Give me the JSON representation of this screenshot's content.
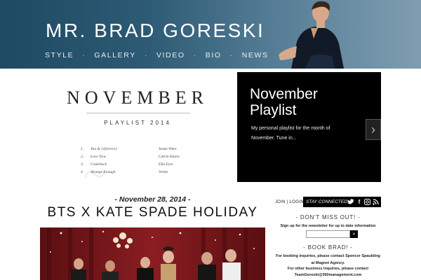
{
  "header": {
    "title": "MR. BRAD GORESKI",
    "nav": [
      "STYLE",
      "GALLERY",
      "VIDEO",
      "BIO",
      "NEWS"
    ],
    "separator": "·"
  },
  "feature": {
    "image_title": "NOVEMBER",
    "image_subtitle": "PLAYLIST 2014",
    "tracks": [
      {
        "num": "1.",
        "song": "You & I (forever)",
        "artist": "Jessie Ware"
      },
      {
        "num": "2.",
        "song": "Love Now",
        "artist": "Calvin Harris"
      },
      {
        "num": "3.",
        "song": "Comeback",
        "artist": "Ella Eyre"
      },
      {
        "num": "4.",
        "song": "Strange Enough",
        "artist": "Verite"
      }
    ],
    "panel_title": "November Playlist",
    "panel_text": "My personal playlist for the month of November. Tune in...",
    "next_arrow": "›"
  },
  "post": {
    "date": "- November 28, 2014 -",
    "title": "BTS X KATE SPADE HOLIDAY"
  },
  "sidebar": {
    "join_login": "JOIN | LOGIN",
    "stay_connected": "STAY CONNECTED:",
    "social_icons": [
      "twitter-icon",
      "facebook-icon",
      "instagram-icon",
      "rss-icon"
    ],
    "dont_miss_heading": "- DON'T MISS OUT! -",
    "dont_miss_text": "Sign up for the newsletter for up to date information",
    "submit_label": "»",
    "book_heading": "- BOOK BRAD! -",
    "book_text_1": "For booking inquiries, please contact Spencer Spaulding at Magnet Agency.",
    "book_text_2": "For other business inquiries, please contact",
    "book_email": "TeamGoreski@360management.com"
  },
  "colors": {
    "header_dark": "#1e4a63",
    "header_light": "#7f9db1",
    "panel_bg": "#000000",
    "post_image_red": "#6b1418"
  }
}
